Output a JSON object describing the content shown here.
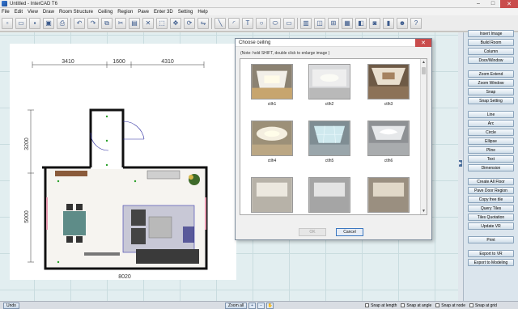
{
  "window": {
    "title": "Untitled - InterCAD T6",
    "minimize": "–",
    "maximize": "□",
    "close": "✕"
  },
  "menu": [
    "File",
    "Edit",
    "View",
    "Draw",
    "Room Structure",
    "Ceiling",
    "Region",
    "Pave",
    "Enter 3D",
    "Setting",
    "Help"
  ],
  "toolbar_icons": [
    "new-icon",
    "open-icon",
    "save-icon",
    "save-as-icon",
    "print-icon",
    "undo-icon",
    "redo-icon",
    "copy-icon",
    "cut-icon",
    "paste-icon",
    "delete-icon",
    "select-icon",
    "move-icon",
    "rotate-icon",
    "mirror-icon",
    "line-tool-icon",
    "arc-tool-icon",
    "text-tool-icon",
    "circle-tool-icon",
    "ellipse-tool-icon",
    "comment-icon",
    "wall-icon",
    "door-icon",
    "window-icon",
    "furniture-icon",
    "render-icon",
    "camera-icon",
    "cabinet-icon",
    "bed-icon",
    "user-icon",
    "help-icon"
  ],
  "plan": {
    "dim_top": [
      "3410",
      "1600",
      "4310"
    ],
    "dim_left": [
      "3200",
      "5000"
    ],
    "dim_bottom": "8020"
  },
  "dialog": {
    "title": "Choose ceiling",
    "close": "✕",
    "note": "(Note: hold SHIFT, double click to enlarge image )",
    "items": [
      {
        "label": "ctlh1"
      },
      {
        "label": "ctlh2"
      },
      {
        "label": "ctlh3"
      },
      {
        "label": "ctlh4"
      },
      {
        "label": "ctlh5"
      },
      {
        "label": "ctlh6"
      },
      {
        "label": ""
      },
      {
        "label": ""
      },
      {
        "label": ""
      }
    ],
    "ok_label": "OK",
    "cancel_label": "Cancel"
  },
  "right_panel": {
    "buttons": [
      "Insert Image",
      "Build Room",
      "Column",
      "Door/Window",
      "Zoom Extend",
      "Zoom Window",
      "Snap",
      "Snap Setting",
      "Line",
      "Arc",
      "Circle",
      "Ellipse",
      "Pline",
      "Text",
      "Dimension",
      "Create All Floor",
      "Pave Door Region",
      "Copy free tile",
      "Query Tiles",
      "Tiles Quotation",
      "Update VR",
      "Print",
      "Export to VR",
      "Export to Modeling"
    ]
  },
  "status": {
    "undo": "Undo",
    "zoom_all": "Zoom all",
    "snaps": [
      {
        "label": "Snap at length"
      },
      {
        "label": "Snap at angle"
      },
      {
        "label": "Snap at node"
      },
      {
        "label": "Snap at grid"
      }
    ]
  }
}
